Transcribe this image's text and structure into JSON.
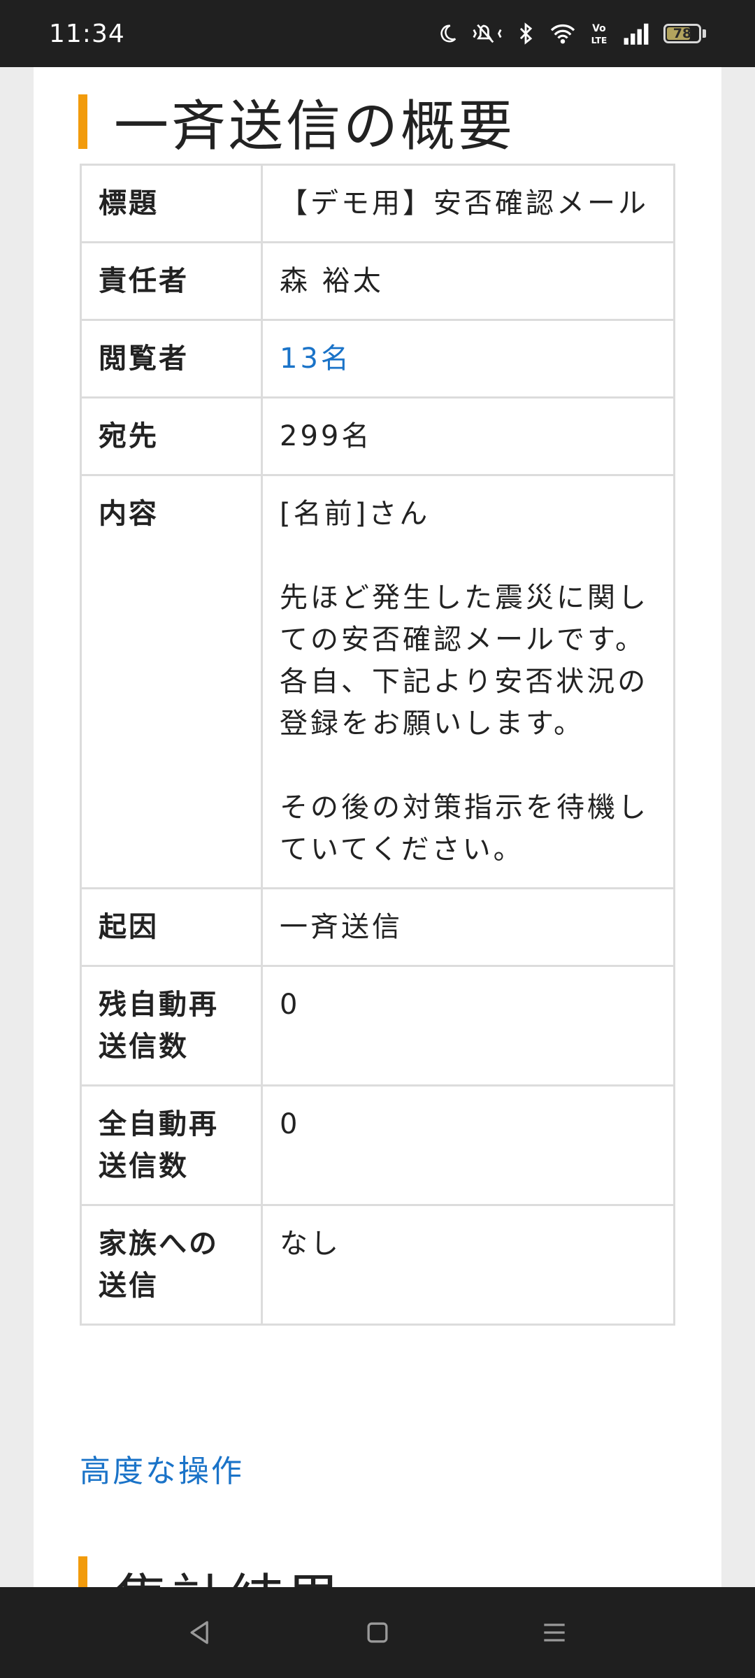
{
  "status": {
    "time": "11:34",
    "battery": "78",
    "battery_level": 0.78,
    "icons": [
      "moon-icon",
      "mute-vibrate-icon",
      "bluetooth-icon",
      "wifi-icon",
      "volte-icon",
      "signal-icon",
      "battery-icon"
    ]
  },
  "section": {
    "title": "一斉送信の概要",
    "accent_color": "#f29b0c"
  },
  "summary_rows": [
    {
      "key": "標題",
      "value": "【デモ用】安否確認メール"
    },
    {
      "key": "責任者",
      "value": "森 裕太"
    },
    {
      "key": "閲覧者",
      "value": "13名",
      "link": true
    },
    {
      "key": "宛先",
      "value": "299名"
    },
    {
      "key": "内容",
      "value": "[名前]さん\n\n先ほど発生した震災に関しての安否確認メールです。\n各自、下記より安否状況の登録をお願いします。\n\nその後の対策指示を待機していてください。"
    },
    {
      "key": "起因",
      "value": "一斉送信"
    },
    {
      "key": "残自動再送信数",
      "value": "0"
    },
    {
      "key": "全自動再送信数",
      "value": "0"
    },
    {
      "key": "家族への送信",
      "value": "なし"
    }
  ],
  "advanced_link": "高度な操作",
  "next_section_title": "集計結果",
  "nav": {
    "icons": [
      "back-icon",
      "home-icon",
      "menu-icon"
    ]
  },
  "colors": {
    "link": "#1a73c8",
    "border": "#dcdcdc"
  }
}
